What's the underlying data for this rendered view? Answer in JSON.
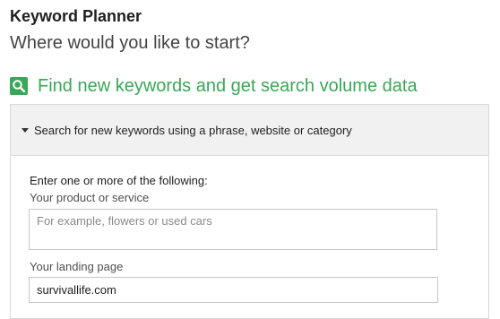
{
  "app": {
    "title": "Keyword Planner",
    "subtitle": "Where would you like to start?"
  },
  "section": {
    "heading": "Find new keywords and get search volume data",
    "icon": "search-icon",
    "accent_color": "#3aa757"
  },
  "panel": {
    "header_label": "Search for new keywords using a phrase, website or category",
    "form_intro": "Enter one or more of the following:",
    "product_field": {
      "label": "Your product or service",
      "placeholder": "For example, flowers or used cars",
      "value": ""
    },
    "landing_field": {
      "label": "Your landing page",
      "value": "survivallife.com"
    }
  }
}
